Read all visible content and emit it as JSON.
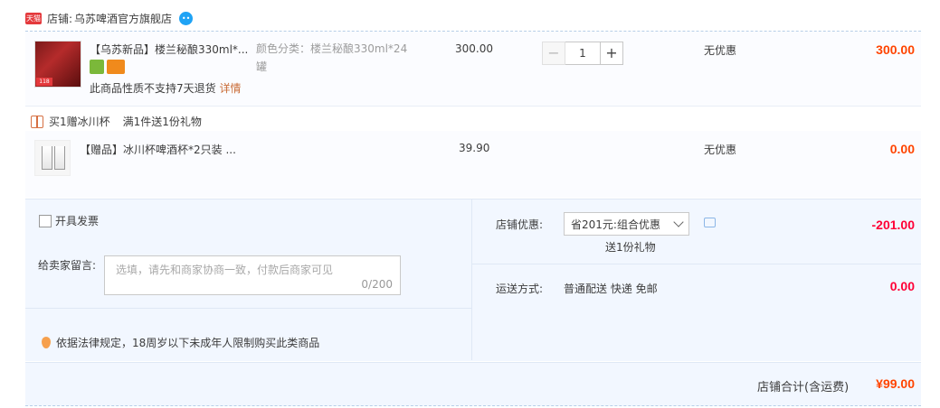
{
  "shop": {
    "badge": "天猫",
    "label": "店铺:",
    "name": "乌苏啤酒官方旗舰店",
    "ww_icon": "chat-bubble-icon"
  },
  "main_item": {
    "title": "【乌苏新品】楼兰秘酿330ml*...",
    "sku_label": "颜色分类：楼兰秘酿330ml*24",
    "sku_label_2": "罐",
    "thumb_label": "118",
    "price": "300.00",
    "quantity": "1",
    "minus": "−",
    "plus": "+",
    "discount": "无优惠",
    "subtotal": "300.00",
    "return_note": "此商品性质不支持7天退货",
    "return_link": "详情"
  },
  "promo": {
    "tag": "买1赠冰川杯",
    "desc": "满1件送1份礼物"
  },
  "gift_item": {
    "title": "【赠品】冰川杯啤酒杯*2只装 ...",
    "price": "39.90",
    "discount": "无优惠",
    "subtotal": "0.00"
  },
  "order": {
    "invoice_label": "开具发票",
    "memo_label": "给卖家留言:",
    "memo_placeholder": "选填，请先和商家协商一致，付款后商家可见",
    "memo_count": "0/200",
    "legal_note": "依据法律规定，18周岁以下未成年人限制购买此类商品",
    "shop_discount_label": "店铺优惠:",
    "shop_discount_selected": "省201元:组合优惠",
    "shop_discount_sub": "送1份礼物",
    "shop_discount_amount": "-201.00",
    "shipping_label": "运送方式:",
    "shipping_value": "普通配送 快递 免邮",
    "shipping_amount": "0.00",
    "total_label": "店铺合计(含运费)",
    "total_value": "¥99.00"
  }
}
